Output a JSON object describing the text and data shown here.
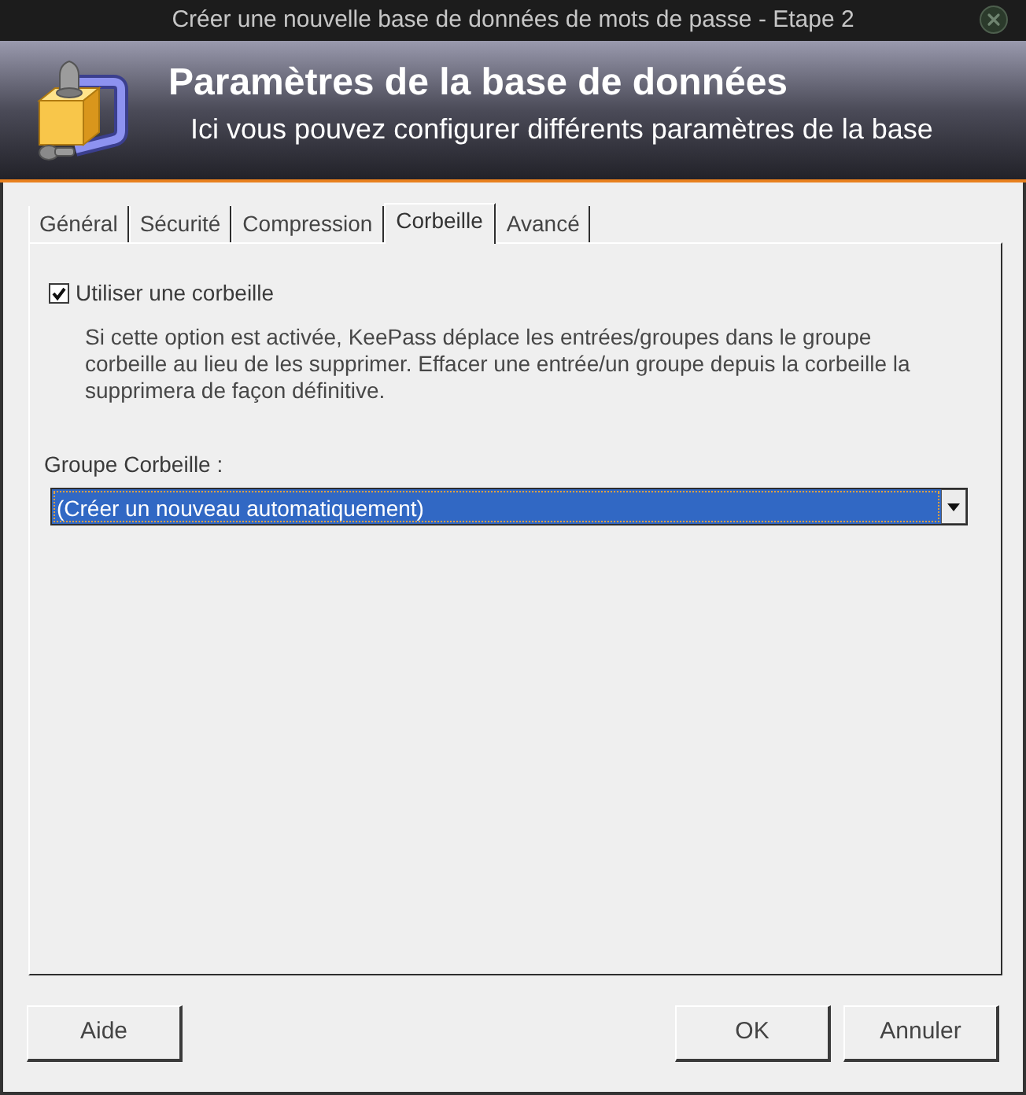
{
  "window": {
    "title": "Créer une nouvelle base de données de mots de passe - Etape 2"
  },
  "header": {
    "title": "Paramètres de la base de données",
    "subtitle": "Ici vous pouvez configurer différents paramètres de la base"
  },
  "tabs": [
    {
      "label": "Général",
      "selected": false
    },
    {
      "label": "Sécurité",
      "selected": false
    },
    {
      "label": "Compression",
      "selected": false
    },
    {
      "label": "Corbeille",
      "selected": true
    },
    {
      "label": "Avancé",
      "selected": false
    }
  ],
  "recycle_bin": {
    "use_recycle_bin": {
      "label": "Utiliser une corbeille",
      "checked": true
    },
    "description": "Si cette option est activée, KeePass déplace les entrées/groupes dans le groupe\ncorbeille au lieu de les supprimer. Effacer une entrée/un groupe depuis la corbeille la\nsupprimera de façon définitive.",
    "group_label": "Groupe Corbeille :",
    "group_select": {
      "value": "(Créer un nouveau automatiquement)",
      "focused": true
    }
  },
  "buttons": {
    "left": [
      {
        "label": "Aide"
      }
    ],
    "right": [
      {
        "label": "OK"
      },
      {
        "label": "Annuler"
      }
    ]
  }
}
